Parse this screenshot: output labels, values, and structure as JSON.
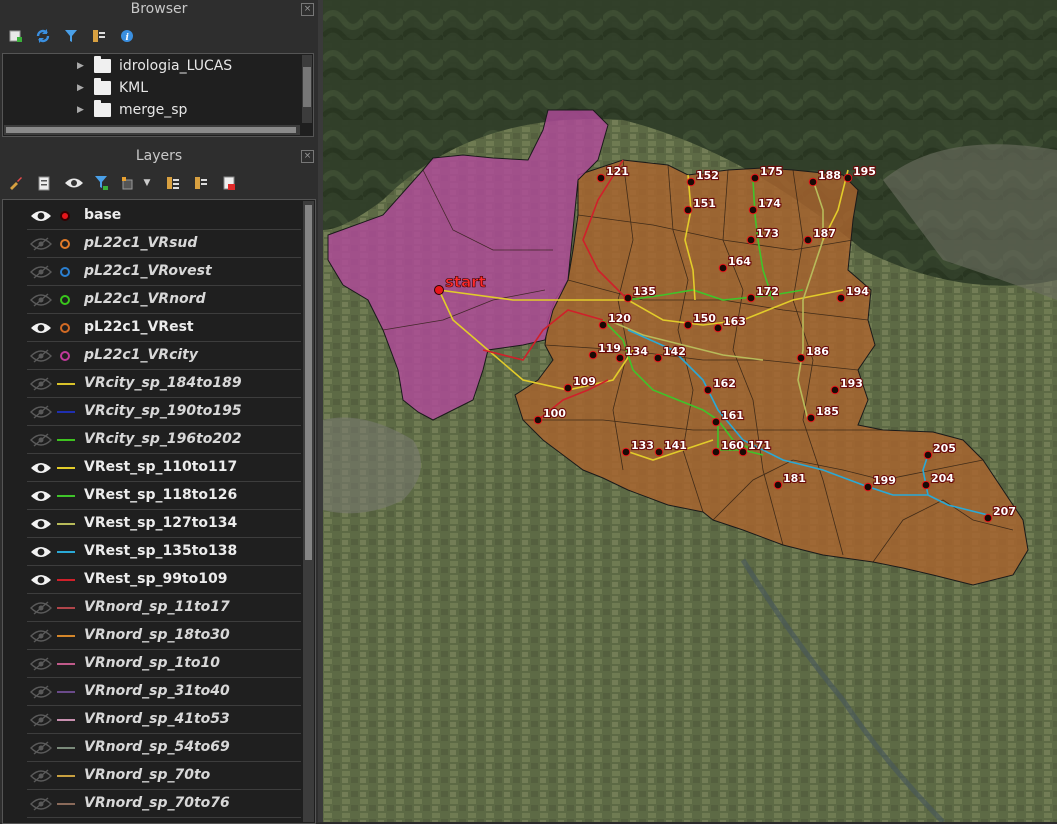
{
  "browser_panel": {
    "title": "Browser",
    "close_icon": "close-panel-icon",
    "toolbar_icons": [
      "add-selected-layers-icon",
      "refresh-icon",
      "filter-icon",
      "collapse-all-icon",
      "properties-icon"
    ],
    "items": [
      {
        "label": "idrologia_LUCAS",
        "icon": "folder-icon"
      },
      {
        "label": "KML",
        "icon": "folder-icon"
      },
      {
        "label": "merge_sp",
        "icon": "folder-icon"
      }
    ]
  },
  "layers_panel": {
    "title": "Layers",
    "close_icon": "close-panel-icon",
    "toolbar_icons": [
      "style-brush-icon",
      "add-group-icon",
      "manage-visibility-icon",
      "filter-legend-icon",
      "filter-by-expression-icon",
      "dropdown-arrow-icon",
      "expand-all-icon",
      "collapse-all-icon",
      "remove-layer-icon"
    ],
    "layers": [
      {
        "name": "base",
        "visible": true,
        "symbol": "dot",
        "color": "#e8151a"
      },
      {
        "name": "pL22c1_VRsud",
        "visible": false,
        "symbol": "dot",
        "color": "#e07a28"
      },
      {
        "name": "pL22c1_VRovest",
        "visible": false,
        "symbol": "dot",
        "color": "#2a7fd0"
      },
      {
        "name": "pL22c1_VRnord",
        "visible": false,
        "symbol": "dot",
        "color": "#39c61c"
      },
      {
        "name": "pL22c1_VRest",
        "visible": true,
        "symbol": "dot",
        "color": "#d16a24"
      },
      {
        "name": "pL22c1_VRcity",
        "visible": false,
        "symbol": "dot",
        "color": "#c0399a"
      },
      {
        "name": "VRcity_sp_184to189",
        "visible": false,
        "symbol": "line",
        "color": "#d9c22a"
      },
      {
        "name": "VRcity_sp_190to195",
        "visible": false,
        "symbol": "line",
        "color": "#1f2fb0"
      },
      {
        "name": "VRcity_sp_196to202",
        "visible": false,
        "symbol": "line",
        "color": "#3ec21f"
      },
      {
        "name": "VRest_sp_110to117",
        "visible": true,
        "symbol": "line",
        "color": "#e2cc2a"
      },
      {
        "name": "VRest_sp_118to126",
        "visible": true,
        "symbol": "line",
        "color": "#3fc42a"
      },
      {
        "name": "VRest_sp_127to134",
        "visible": true,
        "symbol": "line",
        "color": "#b8bb5a"
      },
      {
        "name": "VRest_sp_135to138",
        "visible": true,
        "symbol": "line",
        "color": "#2aa9d6"
      },
      {
        "name": "VRest_sp_99to109",
        "visible": true,
        "symbol": "line",
        "color": "#d0202a"
      },
      {
        "name": "VRnord_sp_11to17",
        "visible": false,
        "symbol": "line",
        "color": "#b0454a"
      },
      {
        "name": "VRnord_sp_18to30",
        "visible": false,
        "symbol": "line",
        "color": "#d4862a"
      },
      {
        "name": "VRnord_sp_1to10",
        "visible": false,
        "symbol": "line",
        "color": "#c05a8a"
      },
      {
        "name": "VRnord_sp_31to40",
        "visible": false,
        "symbol": "line",
        "color": "#6a4a8a"
      },
      {
        "name": "VRnord_sp_41to53",
        "visible": false,
        "symbol": "line",
        "color": "#c890b0"
      },
      {
        "name": "VRnord_sp_54to69",
        "visible": false,
        "symbol": "line",
        "color": "#7a8a7a"
      },
      {
        "name": "VRnord_sp_70to",
        "visible": false,
        "symbol": "line",
        "color": "#c8a040"
      },
      {
        "name": "VRnord_sp_70to76",
        "visible": false,
        "symbol": "line",
        "color": "#8a6a5a"
      }
    ]
  },
  "map": {
    "start_label": "start",
    "point_labels": [
      "121",
      "152",
      "175",
      "188",
      "195",
      "151",
      "174",
      "173",
      "187",
      "164",
      "135",
      "172",
      "194",
      "120",
      "150",
      "163",
      "119",
      "134",
      "142",
      "186",
      "109",
      "162",
      "193",
      "100",
      "161",
      "185",
      "133",
      "141",
      "160",
      "171",
      "205",
      "181",
      "199",
      "204",
      "207"
    ],
    "colors": {
      "city_area": "#b04a9a",
      "east_area": "#a8642e",
      "point": "#e8151a"
    }
  }
}
